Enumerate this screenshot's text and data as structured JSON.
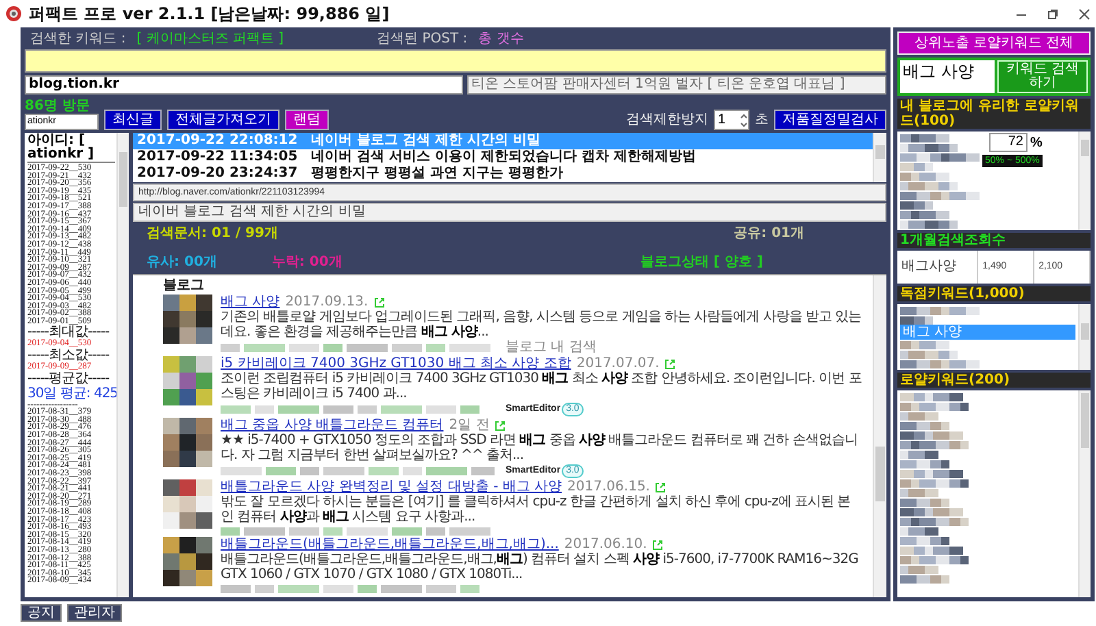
{
  "window": {
    "title": "퍼팩트 프로 ver 2.1.1 [남은날짜: 99,886 일]"
  },
  "search_info": {
    "keyword_label": "검색한 키워드 :",
    "keyword": "[ 케이마스터즈 퍼팩트 ]",
    "post_label": "검색된 POST :",
    "post_count": "총 갯수"
  },
  "blog_address": {
    "value": "blog.tion.kr"
  },
  "blog_title": {
    "value": "티온 스토어팜 판매자센터 1억원 벌자 [ 티온 운호엽 대표님 ]"
  },
  "visitors": "86명 방문",
  "blog_id": {
    "value": "ationkr"
  },
  "buttons": [
    {
      "label": "최신글",
      "kind": "blue"
    },
    {
      "label": "전체글가져오기",
      "kind": "blue"
    },
    {
      "label": "랜덤",
      "kind": "magenta"
    }
  ],
  "delay": {
    "label": "검색제한방지",
    "value": "1",
    "unit": "초"
  },
  "check_button": "저품질정밀검사",
  "visit_log": {
    "header": "아이디: [ ationkr ]",
    "lines": [
      {
        "kind": "date",
        "text": "2017-09-22__530"
      },
      {
        "kind": "date",
        "text": "2017-09-21__432"
      },
      {
        "kind": "date",
        "text": "2017-09-20__356"
      },
      {
        "kind": "date",
        "text": "2017-09-19__435"
      },
      {
        "kind": "date",
        "text": "2017-09-18__521"
      },
      {
        "kind": "date",
        "text": "2017-09-17__388"
      },
      {
        "kind": "date",
        "text": "2017-09-16__437"
      },
      {
        "kind": "date",
        "text": "2017-09-15__367"
      },
      {
        "kind": "date",
        "text": "2017-09-14__409"
      },
      {
        "kind": "date",
        "text": "2017-09-13__482"
      },
      {
        "kind": "date",
        "text": "2017-09-12__438"
      },
      {
        "kind": "date",
        "text": "2017-09-11__449"
      },
      {
        "kind": "date",
        "text": "2017-09-10__321"
      },
      {
        "kind": "date",
        "text": "2017-09-09__287"
      },
      {
        "kind": "date",
        "text": "2017-09-07__432"
      },
      {
        "kind": "date",
        "text": "2017-09-06__440"
      },
      {
        "kind": "date",
        "text": "2017-09-05__499"
      },
      {
        "kind": "date",
        "text": "2017-09-04__530"
      },
      {
        "kind": "date",
        "text": "2017-09-03__482"
      },
      {
        "kind": "date",
        "text": "2017-09-02__388"
      },
      {
        "kind": "date",
        "text": "2017-09-01__509"
      },
      {
        "kind": "separator",
        "text": "-----최대값-----"
      },
      {
        "kind": "max",
        "text": "2017-09-04__530"
      },
      {
        "kind": "separator",
        "text": "-----최소값-----"
      },
      {
        "kind": "min",
        "text": "2017-09-09__287"
      },
      {
        "kind": "separator",
        "text": "-----평균값-----"
      },
      {
        "kind": "avg",
        "text": "30일 평균: 425"
      },
      {
        "kind": "separator",
        "text": "-----------------"
      },
      {
        "kind": "date",
        "text": "2017-08-31__379"
      },
      {
        "kind": "date",
        "text": "2017-08-30__488"
      },
      {
        "kind": "date",
        "text": "2017-08-29__476"
      },
      {
        "kind": "date",
        "text": "2017-08-28__364"
      },
      {
        "kind": "date",
        "text": "2017-08-27__444"
      },
      {
        "kind": "date",
        "text": "2017-08-26__305"
      },
      {
        "kind": "date",
        "text": "2017-08-25__419"
      },
      {
        "kind": "date",
        "text": "2017-08-24__481"
      },
      {
        "kind": "date",
        "text": "2017-08-23__398"
      },
      {
        "kind": "date",
        "text": "2017-08-22__397"
      },
      {
        "kind": "date",
        "text": "2017-08-21__441"
      },
      {
        "kind": "date",
        "text": "2017-08-20__271"
      },
      {
        "kind": "date",
        "text": "2017-08-19__289"
      },
      {
        "kind": "date",
        "text": "2017-08-18__408"
      },
      {
        "kind": "date",
        "text": "2017-08-17__423"
      },
      {
        "kind": "date",
        "text": "2017-08-16__493"
      },
      {
        "kind": "date",
        "text": "2017-08-15__320"
      },
      {
        "kind": "date",
        "text": "2017-08-14__419"
      },
      {
        "kind": "date",
        "text": "2017-08-13__280"
      },
      {
        "kind": "date",
        "text": "2017-08-12__388"
      },
      {
        "kind": "date",
        "text": "2017-08-11__425"
      },
      {
        "kind": "date",
        "text": "2017-08-10__345"
      },
      {
        "kind": "date",
        "text": "2017-08-09__434"
      }
    ]
  },
  "posts": [
    {
      "time": "2017-09-22 22:08:12",
      "title": "네이버 블로그 검색 제한 시간의 비밀",
      "selected": true
    },
    {
      "time": "2017-09-22 11:34:05",
      "title": "네이버 검색 서비스 이용이 제한되었습니다 캡차 제한해제방법",
      "selected": false
    },
    {
      "time": "2017-09-20 23:24:37",
      "title": "평평한지구 평평설 과연 지구는 평평한가",
      "selected": false
    }
  ],
  "post_url": "http://blog.naver.com/ationkr/221103123994",
  "post_title": "네이버 블로그 검색 제한 시간의 비밀",
  "stats": {
    "documents": "검색문서: 01 / 99개",
    "shared": "공유: 01개",
    "similar": "유사: 00개",
    "missing": "누락: 00개",
    "blog_status": "블로그상태 [ 양호 ]"
  },
  "results": {
    "heading": "블로그",
    "items": [
      {
        "title": "배그 사양",
        "date": "2017.09.13.",
        "snippet": "기존의 배틀로얄 게임보다 업그레이드된 그래픽, 음향, 시스템 등으로 게임을 하는 사람들에게 사랑을 받고 있는데요. 좋은 환경을 제공해주는만큼 **배그 사양**...",
        "footer": {
          "kind": "link",
          "text": "블로그 내 검색"
        }
      },
      {
        "title": "i5 카비레이크 7400 3GHz GT1030 배그 최소 사양 조합",
        "date": "2017.07.07.",
        "snippet": "조이런 조립컴퓨터 i5 카비레이크 7400 3GHz GT1030 **배그** 최소 **사양** 조합 안녕하세요. 조이런입니다. 이번 포스팅은 카비레이크 i5 7400 과...",
        "footer": {
          "kind": "badge",
          "name": "SmartEditor",
          "version": "3.0"
        }
      },
      {
        "title": "배그 중옵 사양 배틀그라운드 컴퓨터",
        "date": "2일 전",
        "snippet": "★★ i5-7400 + GTX1050 정도의 조합과 SSD 라면 **배그** 중옵 **사양** 배틀그라운드 컴퓨터로 꽤 건하 손색없습니다. 자 그럼 지금부터 한번 살펴보실까요? ^^ 출처...",
        "footer": {
          "kind": "badge",
          "name": "SmartEditor",
          "version": "3.0"
        }
      },
      {
        "title": "배틀그라운드 사양 완벽정리 및 설정 대방출 - 배그 사양",
        "date": "2017.06.15.",
        "snippet": "밖도 잘 모르겠다 하시는 분들은 [여기] 를 클릭하셔서 cpu-z 한글 간편하게 설치 하신 후에 cpu-z에 표시된 본인 컴퓨터 **사양**과 **배그** 시스템 요구 사항과..."
      },
      {
        "title": "배틀그라운드(배틀그라운드,배틀그라운드,배그,배그)...",
        "date": "2017.06.10.",
        "snippet": "배틀그라운드(배틀그라운드,배틀그라운드,배그,**배그**) 컴퓨터 설치 스펙 **사양** i5-7600, i7-7700K RAM16~32G GTX 1060 / GTX 1070 / GTX 1080 / GTX 1080Ti..."
      }
    ]
  },
  "right_panel": {
    "all_button": "상위노출 로얄키워드 전체",
    "keyword_field": {
      "value": "배그 사양"
    },
    "search_button": "키워드 검색하기",
    "royal_header": "내 블로그에 유리한 로얄키워드(100)",
    "ratio": {
      "value": "72",
      "unit": "%",
      "range": "50% ~ 500%"
    },
    "monthly_header": "1개월검색조회수",
    "monthly": [
      "배그사양",
      "1,490",
      "2,100"
    ],
    "exclusive_header": "독점키워드(1,000)",
    "exclusive_items": [
      {
        "text": "배그 사양",
        "selected": true
      }
    ],
    "royal200_header": "로얄키워드(200)"
  },
  "footer_buttons": [
    "공지",
    "관리자"
  ]
}
